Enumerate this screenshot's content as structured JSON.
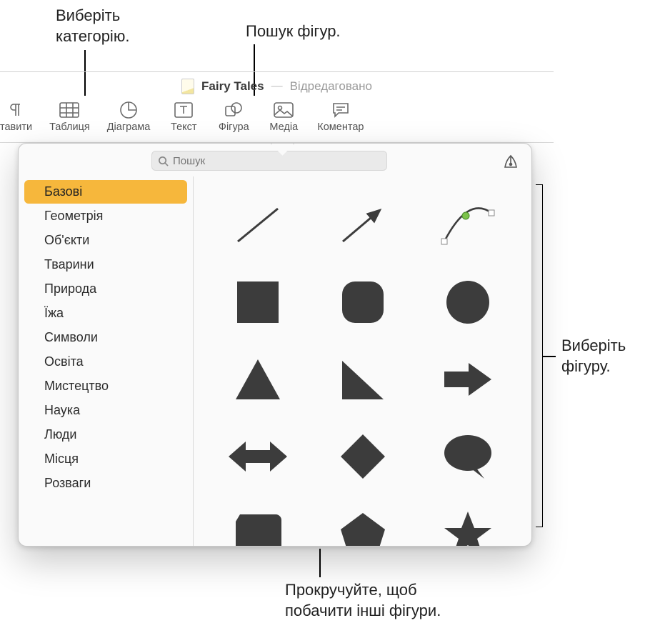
{
  "callouts": {
    "category": "Виберіть\nкатегорію.",
    "search": "Пошук фігур.",
    "select_shape": "Виберіть\nфігуру.",
    "scroll": "Прокручуйте, щоб\nпобачити інші фігури."
  },
  "document": {
    "title": "Fairy Tales",
    "status": "Відредаговано"
  },
  "toolbar": {
    "insert": "тавити",
    "table": "Таблиця",
    "chart": "Діаграма",
    "text": "Текст",
    "shape": "Фігура",
    "media": "Медіа",
    "comment": "Коментар"
  },
  "search": {
    "placeholder": "Пошук"
  },
  "sidebar": {
    "items": [
      {
        "label": "Базові",
        "selected": true
      },
      {
        "label": "Геометрія",
        "selected": false
      },
      {
        "label": "Об'єкти",
        "selected": false
      },
      {
        "label": "Тварини",
        "selected": false
      },
      {
        "label": "Природа",
        "selected": false
      },
      {
        "label": "Їжа",
        "selected": false
      },
      {
        "label": "Символи",
        "selected": false
      },
      {
        "label": "Освіта",
        "selected": false
      },
      {
        "label": "Мистецтво",
        "selected": false
      },
      {
        "label": "Наука",
        "selected": false
      },
      {
        "label": "Люди",
        "selected": false
      },
      {
        "label": "Місця",
        "selected": false
      },
      {
        "label": "Розваги",
        "selected": false
      }
    ]
  },
  "shapes": [
    "line",
    "line-arrow",
    "curve",
    "square",
    "rounded-square",
    "circle",
    "triangle",
    "right-triangle",
    "arrow-right",
    "arrow-both",
    "diamond",
    "speech-bubble",
    "rounded-tab",
    "pentagon",
    "star"
  ]
}
